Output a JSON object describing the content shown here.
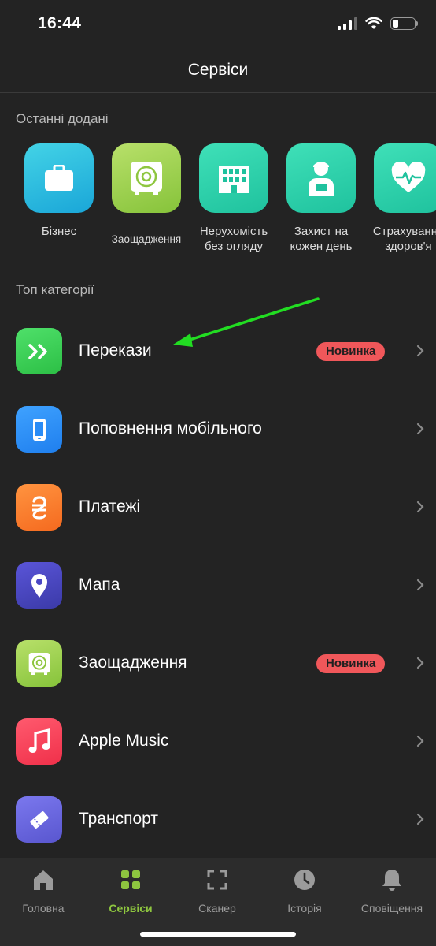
{
  "status_bar": {
    "time": "16:44"
  },
  "header": {
    "title": "Сервіси"
  },
  "recent": {
    "title": "Останні додані",
    "items": [
      {
        "label": "Бізнес",
        "icon": "briefcase-icon"
      },
      {
        "label": "Заощадження",
        "icon": "safe-icon"
      },
      {
        "label": "Нерухомість\nбез огляду",
        "icon": "building-icon"
      },
      {
        "label": "Захист на\nкожен день",
        "icon": "person-icon"
      },
      {
        "label": "Страхування\nздоров'я",
        "icon": "heart-pulse-icon"
      }
    ]
  },
  "top": {
    "title": "Топ категорії",
    "items": [
      {
        "label": "Перекази",
        "badge": "Новинка",
        "icon": "transfer-arrows-icon"
      },
      {
        "label": "Поповнення мобільного",
        "badge": "",
        "icon": "phone-icon"
      },
      {
        "label": "Платежі",
        "badge": "",
        "icon": "hryvnia-icon"
      },
      {
        "label": "Мапа",
        "badge": "",
        "icon": "map-pin-icon"
      },
      {
        "label": "Заощадження",
        "badge": "Новинка",
        "icon": "safe-icon"
      },
      {
        "label": "Apple Music",
        "badge": "",
        "icon": "music-note-icon"
      },
      {
        "label": "Транспорт",
        "badge": "",
        "icon": "ticket-icon"
      }
    ]
  },
  "tabs": [
    {
      "label": "Головна",
      "icon": "home-icon"
    },
    {
      "label": "Сервіси",
      "icon": "grid-icon",
      "active": true
    },
    {
      "label": "Сканер",
      "icon": "scan-icon"
    },
    {
      "label": "Історія",
      "icon": "clock-icon"
    },
    {
      "label": "Сповіщення",
      "icon": "bell-icon"
    }
  ],
  "colors": {
    "background": "#232323",
    "accent_green": "#8ec63f",
    "badge_red": "#f0575a",
    "annotation_arrow": "#22dd22"
  }
}
